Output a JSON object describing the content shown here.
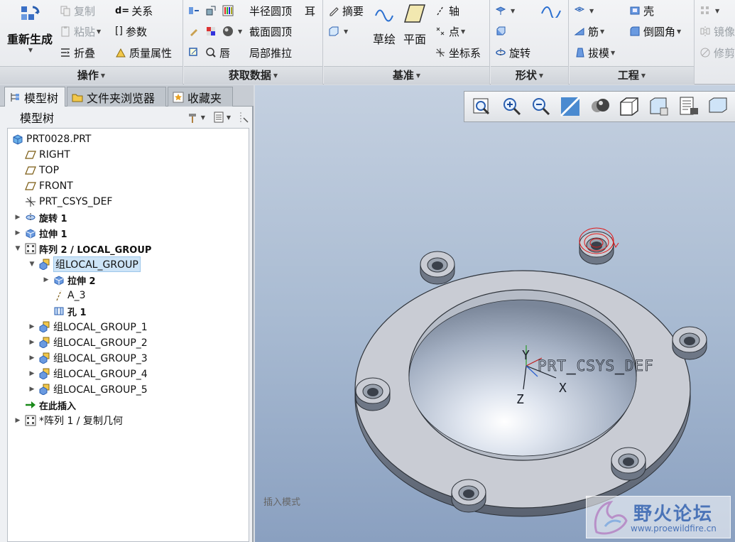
{
  "ribbon": {
    "groups": [
      {
        "label": "操作"
      },
      {
        "label": "获取数据"
      },
      {
        "label": "基准"
      },
      {
        "label": "形状"
      },
      {
        "label": "工程"
      }
    ],
    "operations": {
      "regenerate": "重新生成",
      "copy": "复制",
      "paste": "粘贴",
      "fold": "折叠",
      "relations": "关系",
      "parameters": "参数",
      "mass_props": "质量属性"
    },
    "getdata": {
      "radius_round": "半径圆顶",
      "ear": "耳",
      "section_dome": "截面圆顶",
      "lip": "唇",
      "local_push": "局部推拉"
    },
    "datum": {
      "summary": "摘要",
      "sketch": "草绘",
      "plane": "平面",
      "axis": "轴",
      "point": "点",
      "csys": "坐标系"
    },
    "shape": {
      "revolve": "旋转"
    },
    "engineering": {
      "shell": "壳",
      "rib": "筋",
      "round": "倒圆角",
      "draft": "拔模"
    },
    "overflow": {
      "mirror": "镜像",
      "trim": "修剪"
    }
  },
  "left_panel": {
    "tabs": [
      {
        "label": "模型树"
      },
      {
        "label": "文件夹浏览器"
      },
      {
        "label": "收藏夹"
      }
    ],
    "tree_title": "模型树",
    "tree": [
      {
        "label": "PRT0028.PRT",
        "icon": "part-icon",
        "level": 0,
        "expander": ""
      },
      {
        "label": "RIGHT",
        "icon": "datum-plane-icon",
        "level": 1,
        "expander": ""
      },
      {
        "label": "TOP",
        "icon": "datum-plane-icon",
        "level": 1,
        "expander": ""
      },
      {
        "label": "FRONT",
        "icon": "datum-plane-icon",
        "level": 1,
        "expander": ""
      },
      {
        "label": "PRT_CSYS_DEF",
        "icon": "csys-icon",
        "level": 1,
        "expander": ""
      },
      {
        "label": "旋转 1",
        "icon": "revolve-icon",
        "level": 1,
        "expander": "▶"
      },
      {
        "label": "拉伸 1",
        "icon": "extrude-icon",
        "level": 1,
        "expander": "▶"
      },
      {
        "label": "阵列 2 / LOCAL_GROUP",
        "icon": "pattern-icon",
        "level": 1,
        "expander": "▼"
      },
      {
        "label": "组LOCAL_GROUP",
        "icon": "group-icon",
        "level": 2,
        "expander": "▼",
        "selected": true
      },
      {
        "label": "拉伸 2",
        "icon": "extrude-icon",
        "level": 3,
        "expander": "▶"
      },
      {
        "label": "A_3",
        "icon": "axis-icon",
        "level": 3,
        "expander": ""
      },
      {
        "label": "孔 1",
        "icon": "hole-icon",
        "level": 3,
        "expander": ""
      },
      {
        "label": "组LOCAL_GROUP_1",
        "icon": "group-icon",
        "level": 2,
        "expander": "▶"
      },
      {
        "label": "组LOCAL_GROUP_2",
        "icon": "group-icon",
        "level": 2,
        "expander": "▶"
      },
      {
        "label": "组LOCAL_GROUP_3",
        "icon": "group-icon",
        "level": 2,
        "expander": "▶"
      },
      {
        "label": "组LOCAL_GROUP_4",
        "icon": "group-icon",
        "level": 2,
        "expander": "▶"
      },
      {
        "label": "组LOCAL_GROUP_5",
        "icon": "group-icon",
        "level": 2,
        "expander": "▶"
      },
      {
        "label": "在此插入",
        "icon": "insert-arrow-icon",
        "level": 1,
        "expander": ""
      },
      {
        "label": "*阵列 1 / 复制几何",
        "icon": "pattern-icon",
        "level": 1,
        "expander": "▶"
      }
    ]
  },
  "viewport": {
    "status": "插入模式",
    "csys_label": "PRT_CSYS_DEF",
    "axes": {
      "x": "X",
      "y": "Y",
      "z": "Z"
    },
    "watermark_title": "野火论坛",
    "watermark_url": "www.proewildfire.cn",
    "toolbar_icons": [
      "refit-icon",
      "zoom-in-icon",
      "zoom-out-icon",
      "repaint-icon",
      "display-style-icon",
      "saved-views-icon",
      "view-manager-icon",
      "datum-display-icon",
      "spin-center-icon",
      "annotation-icon"
    ]
  },
  "colors": {
    "ribbon_bg": "#eceef1",
    "viewport_top": "#c4d0e0",
    "viewport_bottom": "#8aa0c0",
    "selection": "#cde4f7",
    "model": "#c9ccd4"
  }
}
